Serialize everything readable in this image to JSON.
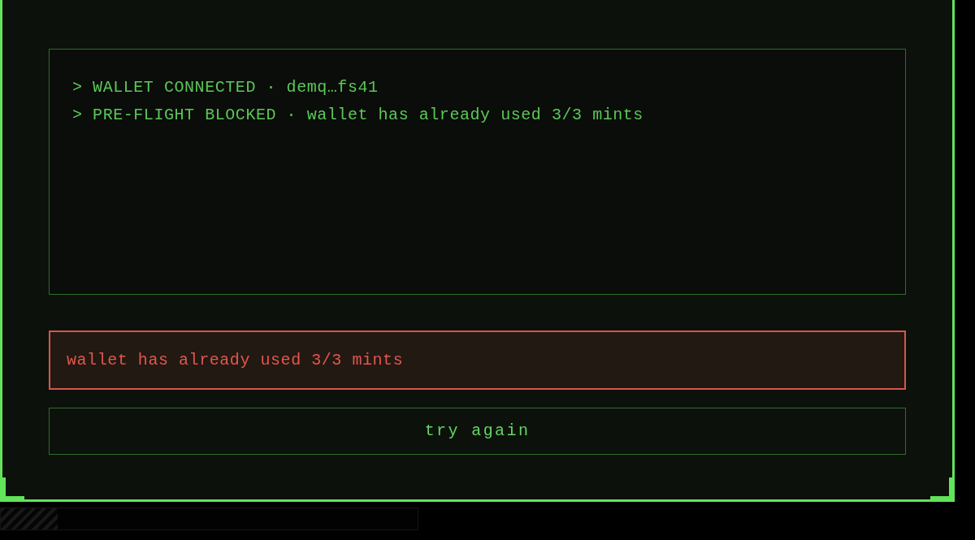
{
  "log": {
    "lines": [
      {
        "text": "> WALLET CONNECTED · demq…fs41"
      },
      {
        "text": "> PRE-FLIGHT BLOCKED · wallet has already used 3/3 mints"
      }
    ]
  },
  "error": {
    "message": "wallet has already used 3/3 mints"
  },
  "buttons": [
    {
      "label": "try again"
    }
  ]
}
